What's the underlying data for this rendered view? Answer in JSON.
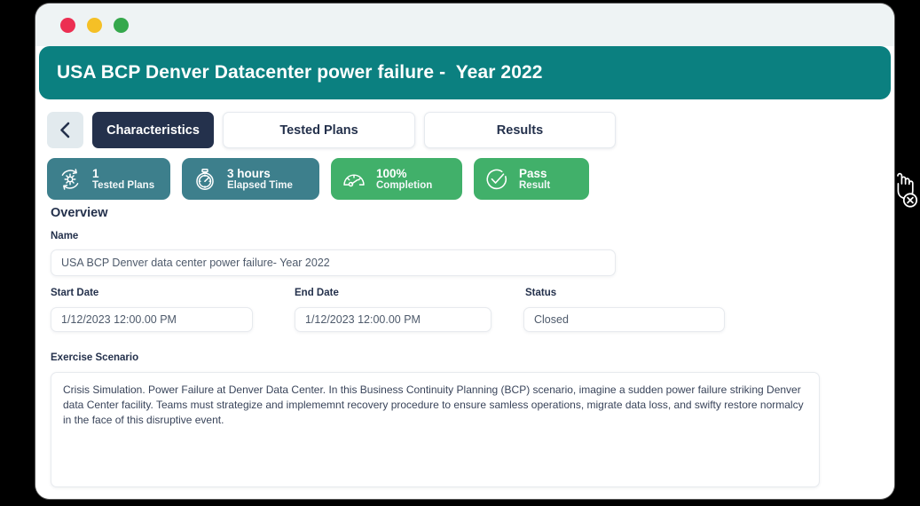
{
  "window": {
    "traffic_lights": [
      "close",
      "minimize",
      "maximize"
    ]
  },
  "header": {
    "title": "USA BCP Denver Datacenter power failure -  Year 2022",
    "brand_color": "#0b8080"
  },
  "nav": {
    "back_icon": "chevron-left-icon",
    "tabs": [
      {
        "label": "Characteristics",
        "active": true
      },
      {
        "label": "Tested Plans",
        "active": false
      },
      {
        "label": "Results",
        "active": false
      }
    ]
  },
  "stat_cards": [
    {
      "icon": "gear-refresh-icon",
      "value": "1",
      "label": "Tested Plans",
      "color": "#3d7f8c"
    },
    {
      "icon": "stopwatch-icon",
      "value": "3 hours",
      "label": "Elapsed Time",
      "color": "#3d7f8c"
    },
    {
      "icon": "gauge-icon",
      "value": "100%",
      "label": "Completion",
      "color": "#41b06a"
    },
    {
      "icon": "check-circle-icon",
      "value": "Pass",
      "label": "Result",
      "color": "#41b06a"
    }
  ],
  "overview": {
    "section_title": "Overview",
    "name": {
      "label": "Name",
      "value": "USA BCP Denver data center power failure- Year 2022",
      "placeholder": "Name"
    },
    "start_date": {
      "label": "Start Date",
      "value": "1/12/2023 12:00.00 PM",
      "placeholder": "Start Date"
    },
    "end_date": {
      "label": "End Date",
      "value": "1/12/2023 12:00.00 PM",
      "placeholder": "End Date"
    },
    "status": {
      "label": "Status",
      "value": "Closed",
      "placeholder": "Status"
    },
    "scenario": {
      "label": "Exercise Scenario",
      "value": "Crisis Simulation. Power Failure at Denver Data Center. In this Business Continuity Planning (BCP) scenario, imagine a sudden power failure striking Denver data Center facility. Teams must strategize and implememnt recovery procedure to ensure samless operations, migrate data loss, and swifty restore normalcy in the face of this disruptive event.",
      "placeholder": "Exercise Scenario"
    }
  },
  "cursor": {
    "icon": "pointer-no-drop-cursor"
  }
}
